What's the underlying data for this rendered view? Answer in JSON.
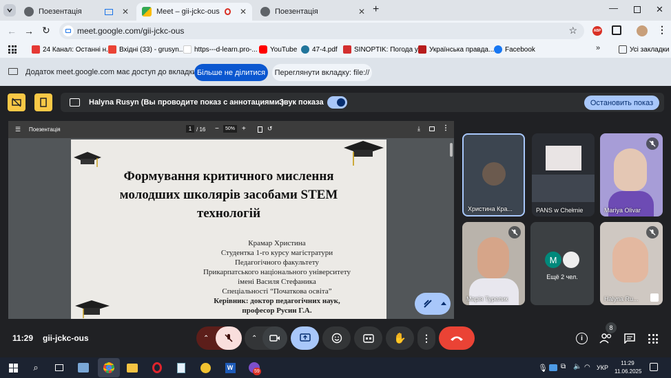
{
  "tabs": [
    {
      "label": "Поезентація"
    },
    {
      "label": "Meet – gii-jckc-ous"
    },
    {
      "label": "Поезентація"
    }
  ],
  "address": {
    "url": "meet.google.com/gii-jckc-ous"
  },
  "extension_badge": "ABP",
  "bookmarks": [
    {
      "label": "24 Канал: Останні н..."
    },
    {
      "label": "Вхідні (33) - grusyn..."
    },
    {
      "label": "https---d-learn.pro-..."
    },
    {
      "label": "YouTube"
    },
    {
      "label": "47-4.pdf"
    },
    {
      "label": "SINOPTIK: Погода у..."
    },
    {
      "label": "Українська правда..."
    },
    {
      "label": "Facebook"
    }
  ],
  "bookmarks_all": "Усі закладки",
  "infobar": {
    "text": "Додаток meet.google.com має доступ до вкладки file://",
    "stop_label": "Більше не ділитися",
    "view_label": "Переглянути вкладку: file://"
  },
  "presenting": {
    "text": "Halyna Rusyn (Вы проводите показ с аннотациями.)",
    "sound_label": "Звук показа",
    "stop_label": "Остановить показ"
  },
  "pdf": {
    "title": "Поезентація",
    "page_current": "1",
    "page_total": "/ 16",
    "zoom": "50%"
  },
  "slide": {
    "title_lines": [
      "Формування критичного мислення",
      "молодших школярів засобами STEM",
      "технологій"
    ],
    "author_lines": [
      "Крамар Христина",
      "Студентка 1-го курсу  магістратури",
      "Педагогічного факультету",
      "Прикарпатського національного університету",
      "імені Василя Стефаника",
      "Спеціальності “Початкова освіта”"
    ],
    "supervisor_lines": [
      "Керівник: доктор педагогічних наук,",
      "професор Русин Г.А."
    ]
  },
  "participants": [
    {
      "name": "Христина Кра..."
    },
    {
      "name": "PANS w Chełmie"
    },
    {
      "name": "Mariya Olivar"
    },
    {
      "name": "Марія Турелик"
    },
    {
      "name": "Ещё 2 чел.",
      "initial": "M"
    },
    {
      "name": "Halyna Ru..."
    }
  ],
  "meeting": {
    "time": "11:29",
    "code": "gii-jckc-ous",
    "people_count": "8"
  },
  "taskbar": {
    "lang": "УКР",
    "time": "11:29",
    "date": "11.06.2025",
    "viber_badge": "59"
  },
  "colors": {
    "accent": "#a8c7fa",
    "end_call": "#ea4335",
    "warn": "#f9c846"
  }
}
